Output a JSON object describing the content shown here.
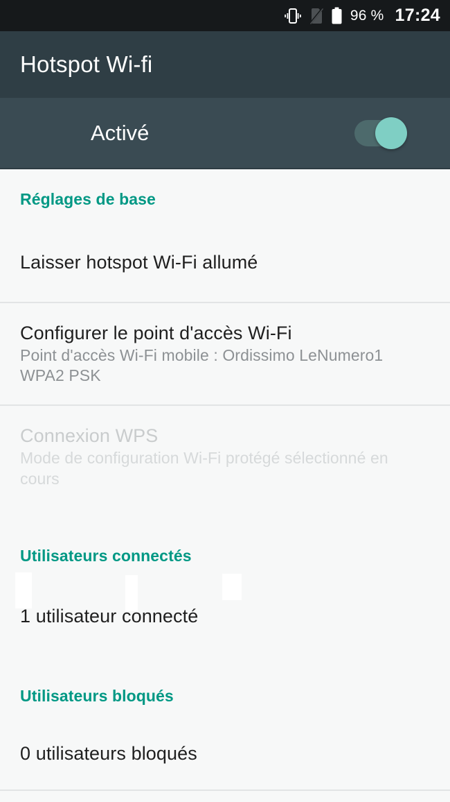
{
  "status_bar": {
    "icons": [
      "vibrate-icon",
      "sim-card-off-icon",
      "battery-full-icon"
    ],
    "battery_percent": "96 %",
    "clock": "17:24"
  },
  "header": {
    "title": "Hotspot Wi-fi"
  },
  "toggle": {
    "label": "Activé",
    "state": "on",
    "thumb_color": "#7fcfc4",
    "track_color": "#4d6a6c"
  },
  "theme": {
    "accent": "#009884",
    "title_bar_bg": "#2f3e45",
    "toggle_bar_bg": "#3a4b53",
    "status_bar_bg": "#16191b",
    "page_bg": "#f7f8f8",
    "divider": "#e2e4e5"
  },
  "sections": {
    "basic": {
      "header": "Réglages de base",
      "rows": [
        {
          "title": "Laisser hotspot Wi-Fi allumé"
        },
        {
          "title": "Configurer le point d'accès Wi-Fi",
          "sub_line1": "Point d'accès Wi-Fi mobile : Ordissimo LeNumero1",
          "sub_line2": "WPA2 PSK"
        },
        {
          "title": "Connexion WPS",
          "sub_line1": "Mode de configuration Wi-Fi protégé sélectionné en",
          "sub_line2": "cours",
          "disabled": true
        }
      ]
    },
    "connected": {
      "header": "Utilisateurs connectés",
      "row_title": "1 utilisateur  connecté"
    },
    "blocked": {
      "header": "Utilisateurs bloqués",
      "row_title": "0 utilisateurs bloqués"
    }
  }
}
